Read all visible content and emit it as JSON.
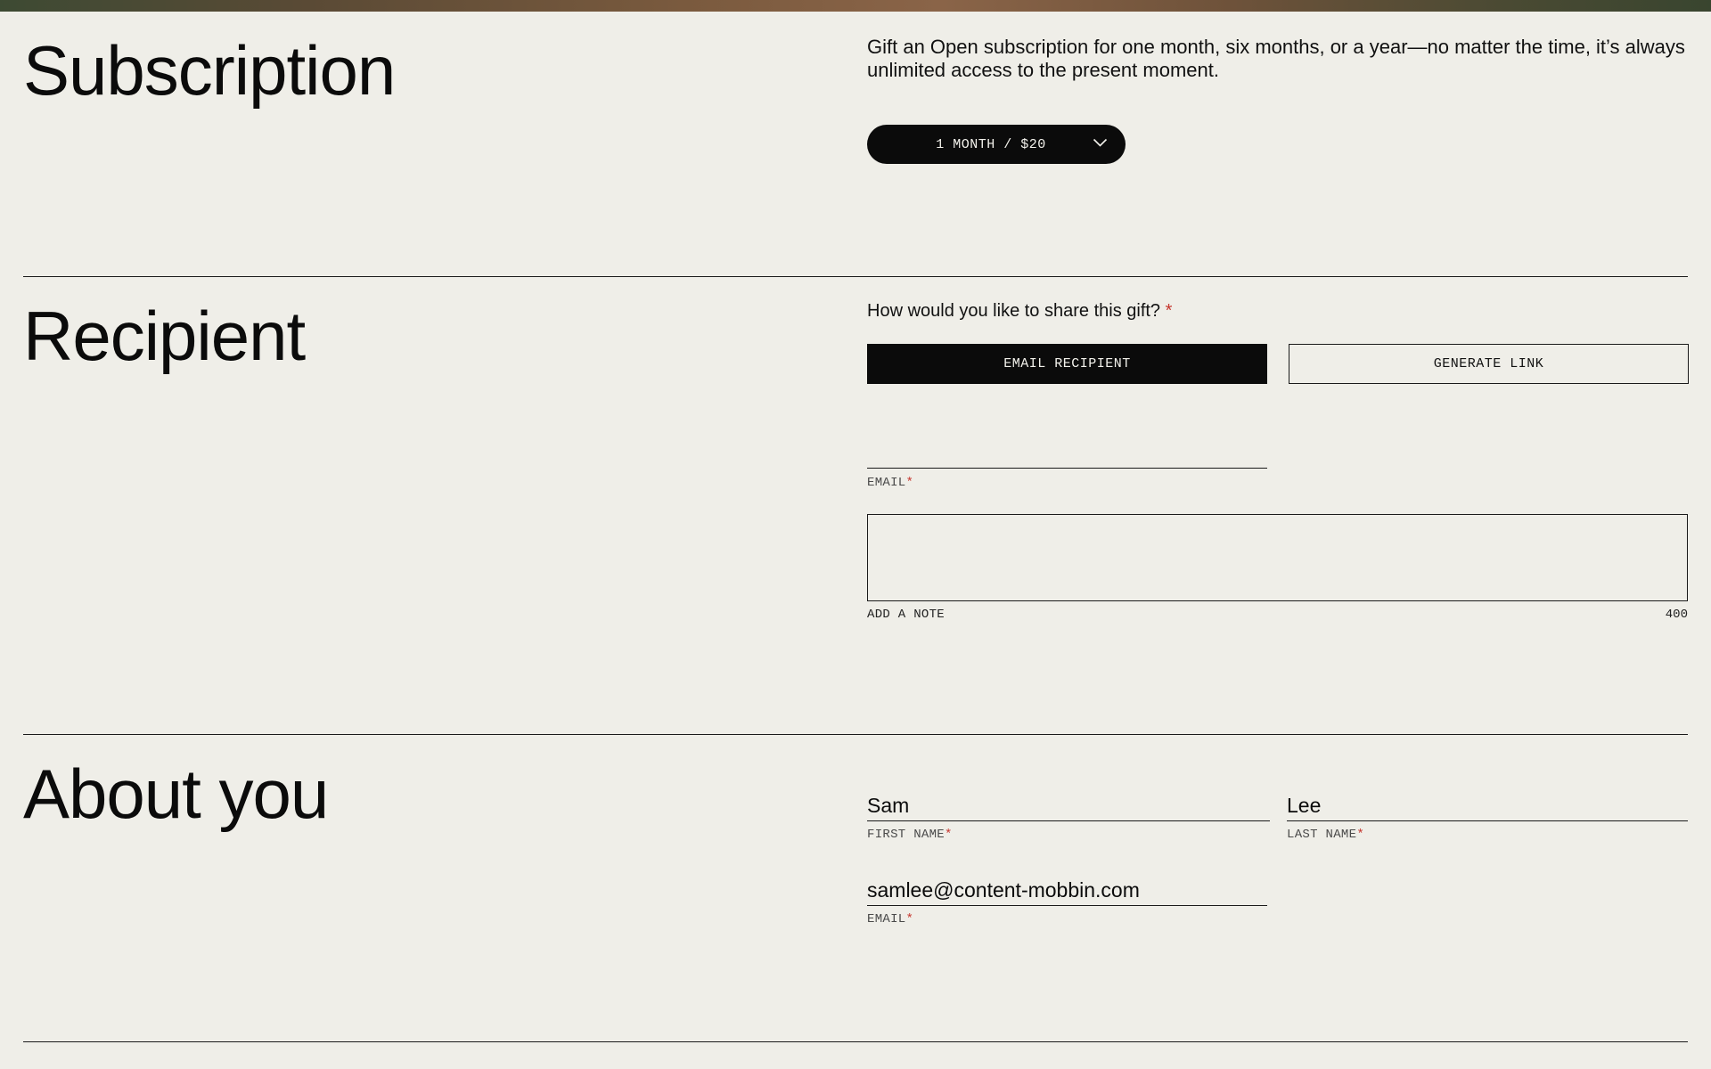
{
  "subscription": {
    "title": "Subscription",
    "description": "Gift an Open subscription for one month, six months, or a year—no matter the time, it’s always unlimited access to the present moment.",
    "plan_select_value": "1 MONTH / $20",
    "plan_select_icon": "chevron-down-icon"
  },
  "recipient": {
    "title": "Recipient",
    "share_question": "How would you like to share this gift?",
    "required_mark": "*",
    "share_options": [
      "EMAIL RECIPIENT",
      "GENERATE LINK"
    ],
    "selected_option": "EMAIL RECIPIENT",
    "email_value": "",
    "email_label": "EMAIL",
    "note_value": "",
    "note_label": "ADD A NOTE",
    "note_char_limit": "400"
  },
  "about_you": {
    "title": "About you",
    "first_name_value": "Sam",
    "first_name_label": "FIRST NAME",
    "last_name_value": "Lee",
    "last_name_label": "LAST NAME",
    "email_value": "samlee@content-mobbin.com",
    "email_label": "EMAIL",
    "required_mark": "*"
  },
  "colors": {
    "background": "#efeee8",
    "primary": "#0b0b0b",
    "required": "#c6352d"
  }
}
